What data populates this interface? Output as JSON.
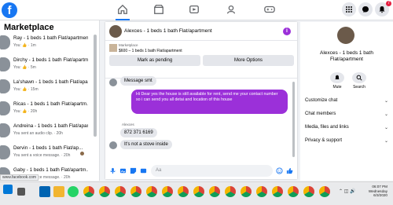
{
  "nav": {
    "logo": "f",
    "watch_badge": "",
    "notifications_badge": "7",
    "icons": [
      "home-icon",
      "store-icon",
      "watch-icon",
      "groups-icon",
      "gaming-icon",
      "menu-icon",
      "messenger-icon",
      "notifications-icon",
      "account-icon"
    ]
  },
  "sidebar": {
    "title": "Marketplace",
    "items": [
      {
        "name": "Ray - 1 beds 1 bath Flat/apartment",
        "sub": "You: 👍 · 1m"
      },
      {
        "name": "Dirchy - 1 beds 1 bath Flat/apartment",
        "sub": "You: 👍 · 5m"
      },
      {
        "name": "La'shawn - 1 beds 1 bath Flat/apart...",
        "sub": "You: 👍 · 15m"
      },
      {
        "name": "Ricas - 1 beds 1 bath Flat/apartm...",
        "sub": "You: 👍 · 20h"
      },
      {
        "name": "Andreina - 1 beds 1 bath Flat/apart...",
        "sub": "You sent an audio clip. · 20h"
      },
      {
        "name": "Dervin - 1 beds 1 bath Flat/ap...",
        "sub": "You sent a voice message. · 20h"
      },
      {
        "name": "Gaby - 1 beds 1 bath Flat/apartm...",
        "sub": "You sent a voice message. · 20h"
      }
    ],
    "status_url": "www.facebook.com"
  },
  "chat": {
    "title": "Alexces - 1 beds 1 bath Flat/apartment",
    "listing_label": "Marketplace",
    "listing_price": "$600 – 1 beds 1 bath Flat/apartment",
    "mark_pending": "Mark as pending",
    "more_options": "More Options",
    "messages": {
      "in1": "Message smt",
      "out1": "Hi Dear yes the house is still available for rent, send me your contact number so i can send you all detai and location of this house",
      "sender": "Alexces",
      "in2": "872 371 6169",
      "in3": "It's not a stove inside"
    },
    "composer_placeholder": "Aa"
  },
  "rpanel": {
    "title": "Alexces - 1 beds 1 bath Flat/apartment",
    "mute": "Mute",
    "search": "Search",
    "rows": [
      "Customize chat",
      "Chat members",
      "Media, files and links",
      "Privacy & support"
    ]
  },
  "taskbar": {
    "time": "06:07 PM",
    "day": "Wednesday",
    "date": "6/3/2020",
    "lang": "ENG"
  },
  "colors": {
    "accent": "#1877f2",
    "bubble_out": "#9b30d9"
  }
}
